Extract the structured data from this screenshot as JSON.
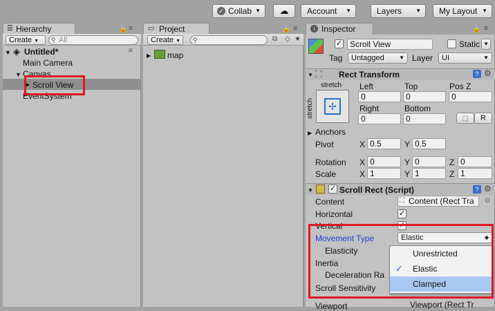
{
  "toolbar": {
    "collab": "Collab",
    "account": "Account",
    "layers": "Layers",
    "layout": "My Layout"
  },
  "hierarchy": {
    "tab": "Hierarchy",
    "create": "Create",
    "search_placeholder": "All",
    "scene": "Untitled*",
    "items": [
      "Main Camera",
      "Canvas",
      "Scroll View",
      "EventSystem"
    ]
  },
  "project": {
    "tab": "Project",
    "create": "Create",
    "items": [
      "map"
    ]
  },
  "inspector": {
    "tab": "Inspector",
    "object_name": "Scroll View",
    "static_label": "Static",
    "tag_label": "Tag",
    "tag_value": "Untagged",
    "layer_label": "Layer",
    "layer_value": "UI",
    "rect_transform": {
      "title": "Rect Transform",
      "stretch_top": "stretch",
      "stretch_side": "stretch",
      "left_label": "Left",
      "top_label": "Top",
      "posz_label": "Pos Z",
      "left": "0",
      "top": "0",
      "posz": "0",
      "right_label": "Right",
      "bottom_label": "Bottom",
      "right": "0",
      "bottom": "0",
      "r_button": "R",
      "anchors": "Anchors",
      "pivot": "Pivot",
      "pivot_x": "0.5",
      "pivot_y": "0.5",
      "rotation": "Rotation",
      "rot_x": "0",
      "rot_y": "0",
      "rot_z": "0",
      "scale": "Scale",
      "scale_x": "1",
      "scale_y": "1",
      "scale_z": "1",
      "x": "X",
      "y": "Y",
      "z": "Z"
    },
    "scroll_rect": {
      "title": "Scroll Rect (Script)",
      "content_label": "Content",
      "content_value": "Content (Rect Tra",
      "horizontal": "Horizontal",
      "vertical": "Vertical",
      "movement_type": "Movement Type",
      "movement_value": "Elastic",
      "elasticity": "Elasticity",
      "inertia": "Inertia",
      "deceleration": "Deceleration Ra",
      "scroll_sensitivity": "Scroll Sensitivity",
      "viewport_label": "Viewport",
      "viewport_value": "Viewport (Rect Tr"
    },
    "dropdown_options": [
      "Unrestricted",
      "Elastic",
      "Clamped"
    ]
  },
  "colors": {
    "highlight": "#e0161f",
    "selected_menu": "#a8c8f0",
    "blue_label": "#1a3fcf"
  }
}
